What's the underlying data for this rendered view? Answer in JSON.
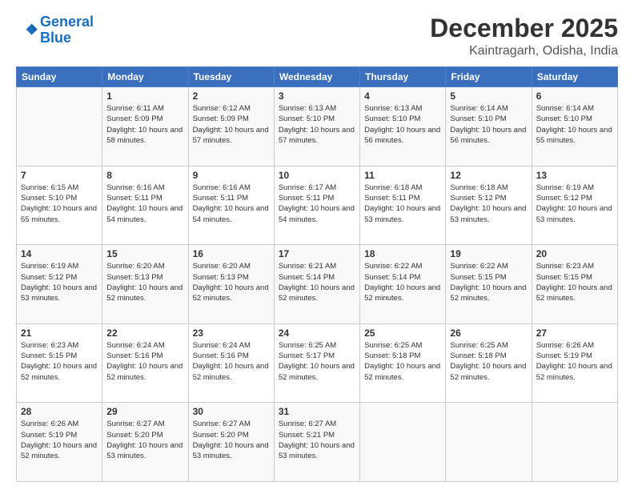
{
  "header": {
    "logo_line1": "General",
    "logo_line2": "Blue",
    "month": "December 2025",
    "location": "Kaintragarh, Odisha, India"
  },
  "weekdays": [
    "Sunday",
    "Monday",
    "Tuesday",
    "Wednesday",
    "Thursday",
    "Friday",
    "Saturday"
  ],
  "weeks": [
    [
      {
        "day": "",
        "sunrise": "",
        "sunset": "",
        "daylight": ""
      },
      {
        "day": "1",
        "sunrise": "Sunrise: 6:11 AM",
        "sunset": "Sunset: 5:09 PM",
        "daylight": "Daylight: 10 hours and 58 minutes."
      },
      {
        "day": "2",
        "sunrise": "Sunrise: 6:12 AM",
        "sunset": "Sunset: 5:09 PM",
        "daylight": "Daylight: 10 hours and 57 minutes."
      },
      {
        "day": "3",
        "sunrise": "Sunrise: 6:13 AM",
        "sunset": "Sunset: 5:10 PM",
        "daylight": "Daylight: 10 hours and 57 minutes."
      },
      {
        "day": "4",
        "sunrise": "Sunrise: 6:13 AM",
        "sunset": "Sunset: 5:10 PM",
        "daylight": "Daylight: 10 hours and 56 minutes."
      },
      {
        "day": "5",
        "sunrise": "Sunrise: 6:14 AM",
        "sunset": "Sunset: 5:10 PM",
        "daylight": "Daylight: 10 hours and 56 minutes."
      },
      {
        "day": "6",
        "sunrise": "Sunrise: 6:14 AM",
        "sunset": "Sunset: 5:10 PM",
        "daylight": "Daylight: 10 hours and 55 minutes."
      }
    ],
    [
      {
        "day": "7",
        "sunrise": "Sunrise: 6:15 AM",
        "sunset": "Sunset: 5:10 PM",
        "daylight": "Daylight: 10 hours and 55 minutes."
      },
      {
        "day": "8",
        "sunrise": "Sunrise: 6:16 AM",
        "sunset": "Sunset: 5:11 PM",
        "daylight": "Daylight: 10 hours and 54 minutes."
      },
      {
        "day": "9",
        "sunrise": "Sunrise: 6:16 AM",
        "sunset": "Sunset: 5:11 PM",
        "daylight": "Daylight: 10 hours and 54 minutes."
      },
      {
        "day": "10",
        "sunrise": "Sunrise: 6:17 AM",
        "sunset": "Sunset: 5:11 PM",
        "daylight": "Daylight: 10 hours and 54 minutes."
      },
      {
        "day": "11",
        "sunrise": "Sunrise: 6:18 AM",
        "sunset": "Sunset: 5:11 PM",
        "daylight": "Daylight: 10 hours and 53 minutes."
      },
      {
        "day": "12",
        "sunrise": "Sunrise: 6:18 AM",
        "sunset": "Sunset: 5:12 PM",
        "daylight": "Daylight: 10 hours and 53 minutes."
      },
      {
        "day": "13",
        "sunrise": "Sunrise: 6:19 AM",
        "sunset": "Sunset: 5:12 PM",
        "daylight": "Daylight: 10 hours and 53 minutes."
      }
    ],
    [
      {
        "day": "14",
        "sunrise": "Sunrise: 6:19 AM",
        "sunset": "Sunset: 5:12 PM",
        "daylight": "Daylight: 10 hours and 53 minutes."
      },
      {
        "day": "15",
        "sunrise": "Sunrise: 6:20 AM",
        "sunset": "Sunset: 5:13 PM",
        "daylight": "Daylight: 10 hours and 52 minutes."
      },
      {
        "day": "16",
        "sunrise": "Sunrise: 6:20 AM",
        "sunset": "Sunset: 5:13 PM",
        "daylight": "Daylight: 10 hours and 52 minutes."
      },
      {
        "day": "17",
        "sunrise": "Sunrise: 6:21 AM",
        "sunset": "Sunset: 5:14 PM",
        "daylight": "Daylight: 10 hours and 52 minutes."
      },
      {
        "day": "18",
        "sunrise": "Sunrise: 6:22 AM",
        "sunset": "Sunset: 5:14 PM",
        "daylight": "Daylight: 10 hours and 52 minutes."
      },
      {
        "day": "19",
        "sunrise": "Sunrise: 6:22 AM",
        "sunset": "Sunset: 5:15 PM",
        "daylight": "Daylight: 10 hours and 52 minutes."
      },
      {
        "day": "20",
        "sunrise": "Sunrise: 6:23 AM",
        "sunset": "Sunset: 5:15 PM",
        "daylight": "Daylight: 10 hours and 52 minutes."
      }
    ],
    [
      {
        "day": "21",
        "sunrise": "Sunrise: 6:23 AM",
        "sunset": "Sunset: 5:15 PM",
        "daylight": "Daylight: 10 hours and 52 minutes."
      },
      {
        "day": "22",
        "sunrise": "Sunrise: 6:24 AM",
        "sunset": "Sunset: 5:16 PM",
        "daylight": "Daylight: 10 hours and 52 minutes."
      },
      {
        "day": "23",
        "sunrise": "Sunrise: 6:24 AM",
        "sunset": "Sunset: 5:16 PM",
        "daylight": "Daylight: 10 hours and 52 minutes."
      },
      {
        "day": "24",
        "sunrise": "Sunrise: 6:25 AM",
        "sunset": "Sunset: 5:17 PM",
        "daylight": "Daylight: 10 hours and 52 minutes."
      },
      {
        "day": "25",
        "sunrise": "Sunrise: 6:25 AM",
        "sunset": "Sunset: 5:18 PM",
        "daylight": "Daylight: 10 hours and 52 minutes."
      },
      {
        "day": "26",
        "sunrise": "Sunrise: 6:25 AM",
        "sunset": "Sunset: 5:18 PM",
        "daylight": "Daylight: 10 hours and 52 minutes."
      },
      {
        "day": "27",
        "sunrise": "Sunrise: 6:26 AM",
        "sunset": "Sunset: 5:19 PM",
        "daylight": "Daylight: 10 hours and 52 minutes."
      }
    ],
    [
      {
        "day": "28",
        "sunrise": "Sunrise: 6:26 AM",
        "sunset": "Sunset: 5:19 PM",
        "daylight": "Daylight: 10 hours and 52 minutes."
      },
      {
        "day": "29",
        "sunrise": "Sunrise: 6:27 AM",
        "sunset": "Sunset: 5:20 PM",
        "daylight": "Daylight: 10 hours and 53 minutes."
      },
      {
        "day": "30",
        "sunrise": "Sunrise: 6:27 AM",
        "sunset": "Sunset: 5:20 PM",
        "daylight": "Daylight: 10 hours and 53 minutes."
      },
      {
        "day": "31",
        "sunrise": "Sunrise: 6:27 AM",
        "sunset": "Sunset: 5:21 PM",
        "daylight": "Daylight: 10 hours and 53 minutes."
      },
      {
        "day": "",
        "sunrise": "",
        "sunset": "",
        "daylight": ""
      },
      {
        "day": "",
        "sunrise": "",
        "sunset": "",
        "daylight": ""
      },
      {
        "day": "",
        "sunrise": "",
        "sunset": "",
        "daylight": ""
      }
    ]
  ]
}
